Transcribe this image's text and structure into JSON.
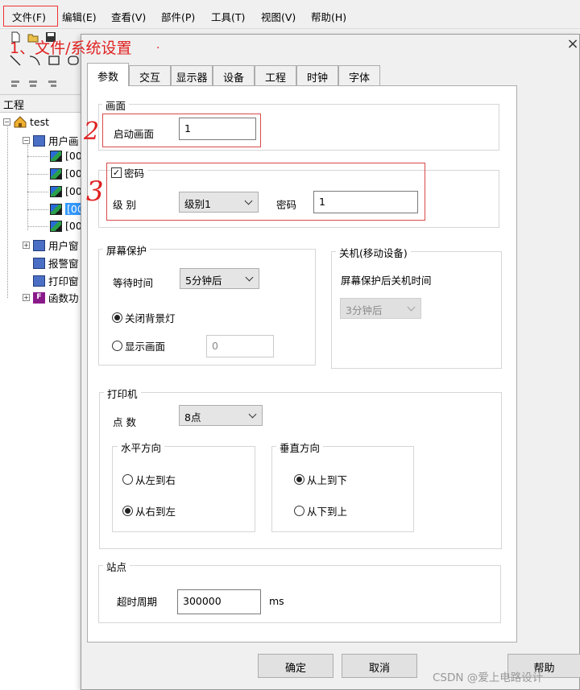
{
  "menubar": {
    "items": [
      "文件(F)",
      "编辑(E)",
      "查看(V)",
      "部件(P)",
      "工具(T)",
      "视图(V)",
      "帮助(H)"
    ]
  },
  "annotations": {
    "step1": "1、文件/系统设置",
    "dot": "·",
    "step2": "2",
    "step3": "3"
  },
  "project_panel": {
    "title": "工程",
    "root": "test",
    "nodes": [
      "用户画",
      "[00",
      "[00",
      "[00",
      "[00",
      "[00",
      "用户窗",
      "报警窗",
      "打印窗",
      "函数功"
    ]
  },
  "dialog": {
    "close": "×",
    "tabs": [
      "参数",
      "交互",
      "显示器",
      "设备",
      "工程",
      "时钟",
      "字体"
    ],
    "screen": {
      "group": "画面",
      "start_label": "启动画面",
      "start_value": "1"
    },
    "password": {
      "check_label": "密码",
      "checked": true,
      "level_label": "级  别",
      "level_value": "级别1",
      "pwd_label": "密码",
      "pwd_value": "1"
    },
    "screensaver": {
      "group": "屏幕保护",
      "wait_label": "等待时间",
      "wait_value": "5分钟后",
      "opt_backlight": "关闭背景灯",
      "opt_screen": "显示画面",
      "screen_value": "0"
    },
    "shutdown": {
      "group": "关机(移动设备)",
      "label": "屏幕保护后关机时间",
      "value": "3分钟后"
    },
    "printer": {
      "group": "打印机",
      "dots_label": "点  数",
      "dots_value": "8点",
      "horizontal": {
        "group": "水平方向",
        "opt1": "从左到右",
        "opt2": "从右到左"
      },
      "vertical": {
        "group": "垂直方向",
        "opt1": "从上到下",
        "opt2": "从下到上"
      }
    },
    "station": {
      "group": "站点",
      "timeout_label": "超时周期",
      "timeout_value": "300000",
      "unit": "ms"
    },
    "buttons": {
      "ok": "确定",
      "cancel": "取消",
      "help": "帮助"
    }
  },
  "watermark": "CSDN @爱上电路设计",
  "colors": {
    "annotation": "#e02020",
    "selection": "#3399ff"
  }
}
